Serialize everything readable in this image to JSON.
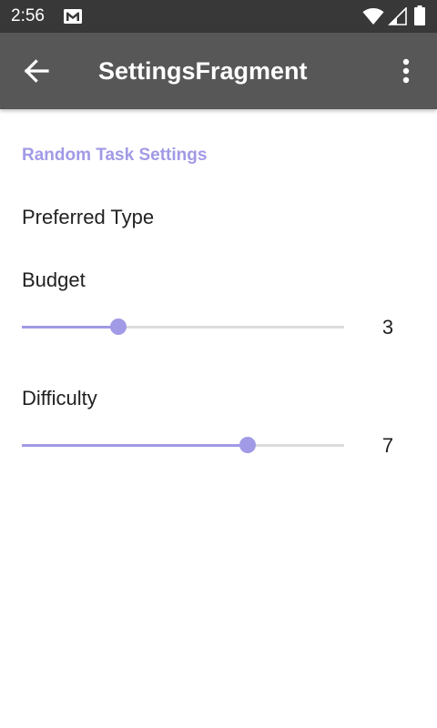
{
  "status_bar": {
    "time": "2:56",
    "icons": [
      "gmail-icon",
      "wifi-icon",
      "cell-signal-icon",
      "battery-icon"
    ]
  },
  "app_bar": {
    "title": "SettingsFragment",
    "back_icon": "arrow-back-icon",
    "overflow_icon": "more-vert-icon"
  },
  "settings": {
    "section_title": "Random Task Settings",
    "preferred_type": {
      "label": "Preferred Type"
    },
    "budget": {
      "label": "Budget",
      "value": "3",
      "fraction": 0.3
    },
    "difficulty": {
      "label": "Difficulty",
      "value": "7",
      "fraction": 0.7
    }
  },
  "colors": {
    "accent": "#a19ae6",
    "status_bar": "#383838",
    "app_bar": "#575757",
    "track": "#dcdcdc"
  }
}
